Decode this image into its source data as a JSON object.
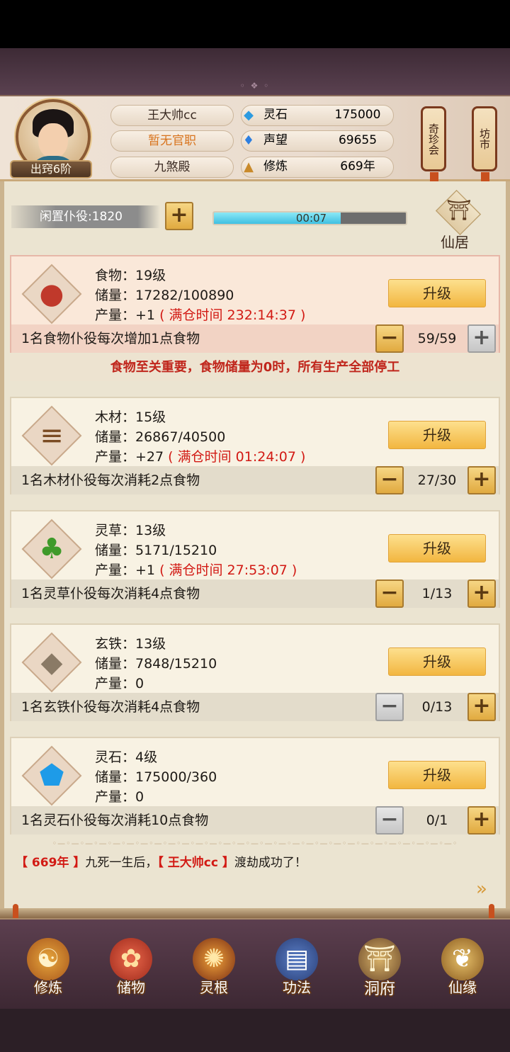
{
  "header": {
    "player_name": "王大帅cc",
    "official_title": "暂无官职",
    "realm": "九煞殿",
    "rank": "出窍6阶",
    "resources": [
      {
        "icon": "spirit-stone-icon",
        "label": "灵石",
        "value": "175000"
      },
      {
        "icon": "prestige-icon",
        "label": "声望",
        "value": "69655"
      },
      {
        "icon": "cultivation-icon",
        "label": "修炼",
        "value": "669年"
      }
    ],
    "lanterns": [
      "奇珍会",
      "坊市"
    ]
  },
  "idle": {
    "label": "闲置仆役:1820",
    "add": "+",
    "timer": "00:07",
    "timer_progress": 0.66
  },
  "residence": {
    "label": "仙居"
  },
  "common": {
    "upgrade": "升级",
    "minus": "−",
    "plus": "+"
  },
  "resources": [
    {
      "key": "food",
      "icon": "meat-icon",
      "name": "食物：19级",
      "storage": "储量：17282/100890",
      "output": "产量：+1",
      "full_time": "( 满仓时间 232:14:37 )",
      "worker_desc": "1名食物仆役每次增加1点食物",
      "count": "59/59",
      "highlight": true
    },
    {
      "key": "wood",
      "icon": "logs-icon",
      "name": "木材：15级",
      "storage": "储量：26867/40500",
      "output": "产量：+27",
      "full_time": "( 满仓时间 01:24:07 )",
      "worker_desc": "1名木材仆役每次消耗2点食物",
      "count": "27/30"
    },
    {
      "key": "herb",
      "icon": "herb-icon",
      "name": "灵草：13级",
      "storage": "储量：5171/15210",
      "output": "产量：+1",
      "full_time": "( 满仓时间 27:53:07 )",
      "worker_desc": "1名灵草仆役每次消耗4点食物",
      "count": "1/13"
    },
    {
      "key": "iron",
      "icon": "ore-icon",
      "name": "玄铁：13级",
      "storage": "储量：7848/15210",
      "output": "产量：0",
      "full_time": "",
      "worker_desc": "1名玄铁仆役每次消耗4点食物",
      "count": "0/13",
      "minus_disabled": true
    },
    {
      "key": "stone",
      "icon": "crystal-icon",
      "name": "灵石：4级",
      "storage": "储量：175000/360",
      "output": "产量：0",
      "full_time": "",
      "worker_desc": "1名灵石仆役每次消耗10点食物",
      "count": "0/1",
      "minus_disabled": true
    }
  ],
  "warning": "食物至关重要，食物储量为0时，所有生产全部停工",
  "log": {
    "year": "【 669年 】",
    "mid": "九死一生后，",
    "name": "【 王大帅cc 】",
    "end": "渡劫成功了！"
  },
  "nav": [
    {
      "label": "修炼",
      "icon": "cultivate-icon"
    },
    {
      "label": "储物",
      "icon": "storage-bag-icon"
    },
    {
      "label": "灵根",
      "icon": "spirit-root-icon"
    },
    {
      "label": "功法",
      "icon": "scripture-icon"
    },
    {
      "label": "洞府",
      "icon": "cave-mansion-icon",
      "active": true
    },
    {
      "label": "仙缘",
      "icon": "fortune-icon"
    }
  ]
}
